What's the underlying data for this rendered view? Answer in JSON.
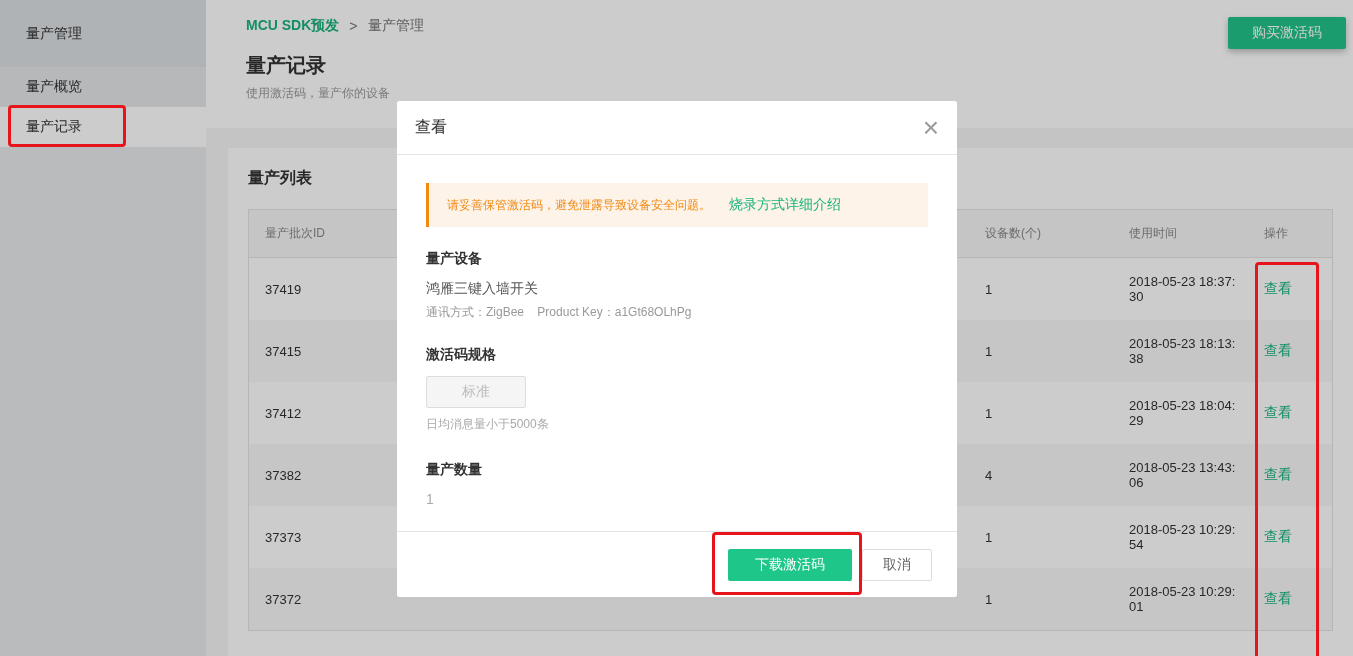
{
  "sidebar": {
    "title": "量产管理",
    "items": [
      {
        "label": "量产概览",
        "selected": false
      },
      {
        "label": "量产记录",
        "selected": true
      }
    ]
  },
  "breadcrumb": {
    "root": "MCU SDK预发",
    "separator": ">",
    "current": "量产管理"
  },
  "page": {
    "title": "量产记录",
    "subtitle": "使用激活码，量产你的设备",
    "action": "购买激活码"
  },
  "card": {
    "title": "量产列表"
  },
  "table": {
    "columns": [
      {
        "label": "量产批次ID"
      },
      {},
      {},
      {},
      {},
      {
        "label": "设备数(个)"
      },
      {
        "label": "使用时间"
      },
      {
        "label": "操作"
      }
    ],
    "rows": [
      {
        "id": "37419",
        "count": "1",
        "time": "2018-05-23 18:37:30",
        "action": "查看"
      },
      {
        "id": "37415",
        "count": "1",
        "time": "2018-05-23 18:13:38",
        "action": "查看"
      },
      {
        "id": "37412",
        "count": "1",
        "time": "2018-05-23 18:04:29",
        "action": "查看"
      },
      {
        "id": "37382",
        "count": "4",
        "time": "2018-05-23 13:43:06",
        "action": "查看"
      },
      {
        "id": "37373",
        "count": "1",
        "time": "2018-05-23 10:29:54",
        "action": "查看"
      },
      {
        "id": "37372",
        "count": "1",
        "time": "2018-05-23 10:29:01",
        "action": "查看"
      }
    ]
  },
  "dialog": {
    "title": "查看",
    "close": "×",
    "notice": "请妥善保管激活码，避免泄露导致设备安全问题。",
    "notice_link": "烧录方式详细介绍",
    "device_label": "量产设备",
    "device_name": "鸿雁三键入墙开关",
    "device_meta": "通讯方式：ZigBee    Product Key：a1Gt68OLhPg",
    "spec_label": "激活码规格",
    "spec_option": {
      "label": "标准",
      "disabled": true
    },
    "spec_hint": "日均消息量小于5000条",
    "qty_label": "量产数量",
    "qty_value": "1",
    "buttons": [
      {
        "label": "下载激活码",
        "kind": "primary"
      },
      {
        "label": "取消",
        "kind": "default"
      }
    ]
  }
}
